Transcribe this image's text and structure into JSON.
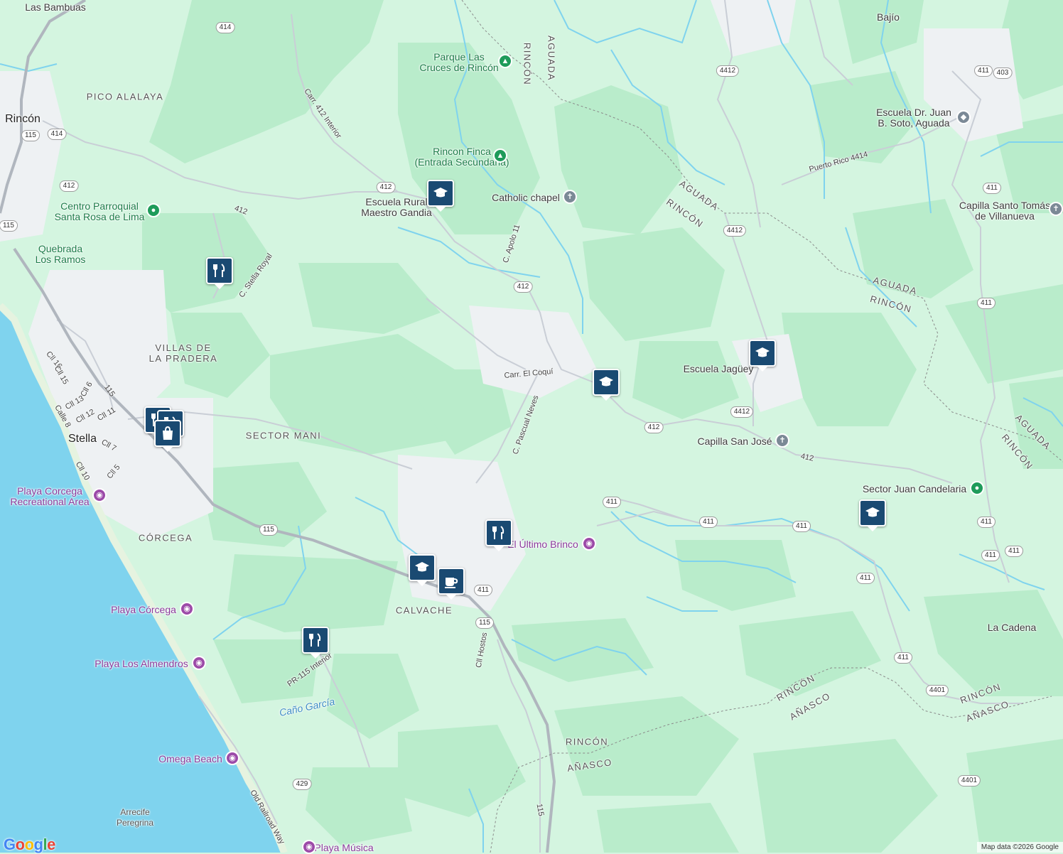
{
  "colors": {
    "land": "#d4f5e0",
    "forest": "#b9eccb",
    "urban": "#eef1f3",
    "water": "#7fd3ee",
    "road": "#c9ced6",
    "highway": "#b0b6be",
    "marker": "#1a4a72"
  },
  "places": {
    "las_bambuas": "Las Bambuas",
    "bajio": "Bajío",
    "pico_alalaya": "PICO ALALAYA",
    "rincon_town": "Rincón",
    "villas_pradera": "VILLAS DE\nLA PRADERA",
    "sector_mani": "SECTOR MANI",
    "stella": "Stella",
    "corcega": "CÓRCEGA",
    "calvache": "CALVACHE",
    "la_cadena": "La Cadena",
    "arrecife": "Arrecife\nPeregrina"
  },
  "boundaries": {
    "aguada": "AGUADA",
    "rincon": "RINCÓN",
    "anasco": "AÑASCO"
  },
  "pois": {
    "parque_cruces": "Parque Las\nCruces de Rincón",
    "rincon_finca": "Rincon Finca\n(Entrada Secundaria)",
    "catholic_chapel": "Catholic chapel",
    "escuela_rural": "Escuela Rural\nMaestro Gandia",
    "centro_parroquial": "Centro Parroquial\nSanta Rosa de Lima",
    "quebrada": "Quebrada\nLos Ramos",
    "escuela_soto": "Escuela Dr. Juan\nB. Soto, Aguada",
    "capilla_santo_tomas": "Capilla Santo Tomás\nde Villanueva",
    "escuela_jaguey": "Escuela Jagüey",
    "capilla_san_jose": "Capilla San José",
    "sector_juan_candelaria": "Sector Juan Candelaria",
    "el_ultimo_brinco": "El Último Brinco",
    "playa_corcega_rec": "Playa Corcega\nRecreational Area",
    "playa_corcega": "Playa Córcega",
    "playa_almendros": "Playa Los Almendros",
    "omega_beach": "Omega Beach",
    "playa_musica": "Playa Música",
    "cano_garcia": "Caño García"
  },
  "streets": {
    "carr_412_interior": "Carr. 412 Interior",
    "c_apolo": "C. Apolo 11",
    "c_stella_royal": "C. Stella Royal",
    "carr_el_coqui": "Carr. El Coquí",
    "c_pascual_neves": "C. Pascual Neves",
    "puerto_rico_4414": "Puerto Rico 4414",
    "cll_16": "Cll 16",
    "cll_15": "Cll 15",
    "cll_6": "Cll 6",
    "cll_13": "Cll 13",
    "cll_12": "Cll 12",
    "cll_11": "Cll 11",
    "calle_8": "Calle 8",
    "cll_7": "Cll 7",
    "cll_10": "Cll 10",
    "cll_5": "Cll 5",
    "cll_hostos": "Cll Hostos",
    "pr_115_interior": "PR-115 Interior",
    "old_railroad": "Old Railroad Way",
    "road_412": "412"
  },
  "shields": [
    "414",
    "414",
    "115",
    "412",
    "412",
    "115",
    "412",
    "4412",
    "4412",
    "411",
    "403",
    "411",
    "411",
    "4412",
    "411",
    "411",
    "411",
    "411",
    "412",
    "411",
    "411",
    "115",
    "411",
    "115",
    "411",
    "4401",
    "4401",
    "429",
    "115"
  ],
  "markers": [
    "school",
    "school",
    "school",
    "school",
    "school",
    "restaurant",
    "restaurant",
    "restaurant",
    "restaurant",
    "shopping",
    "cafe",
    "restaurant"
  ],
  "attribution": "Map data ©2026 Google",
  "logo": "Google"
}
